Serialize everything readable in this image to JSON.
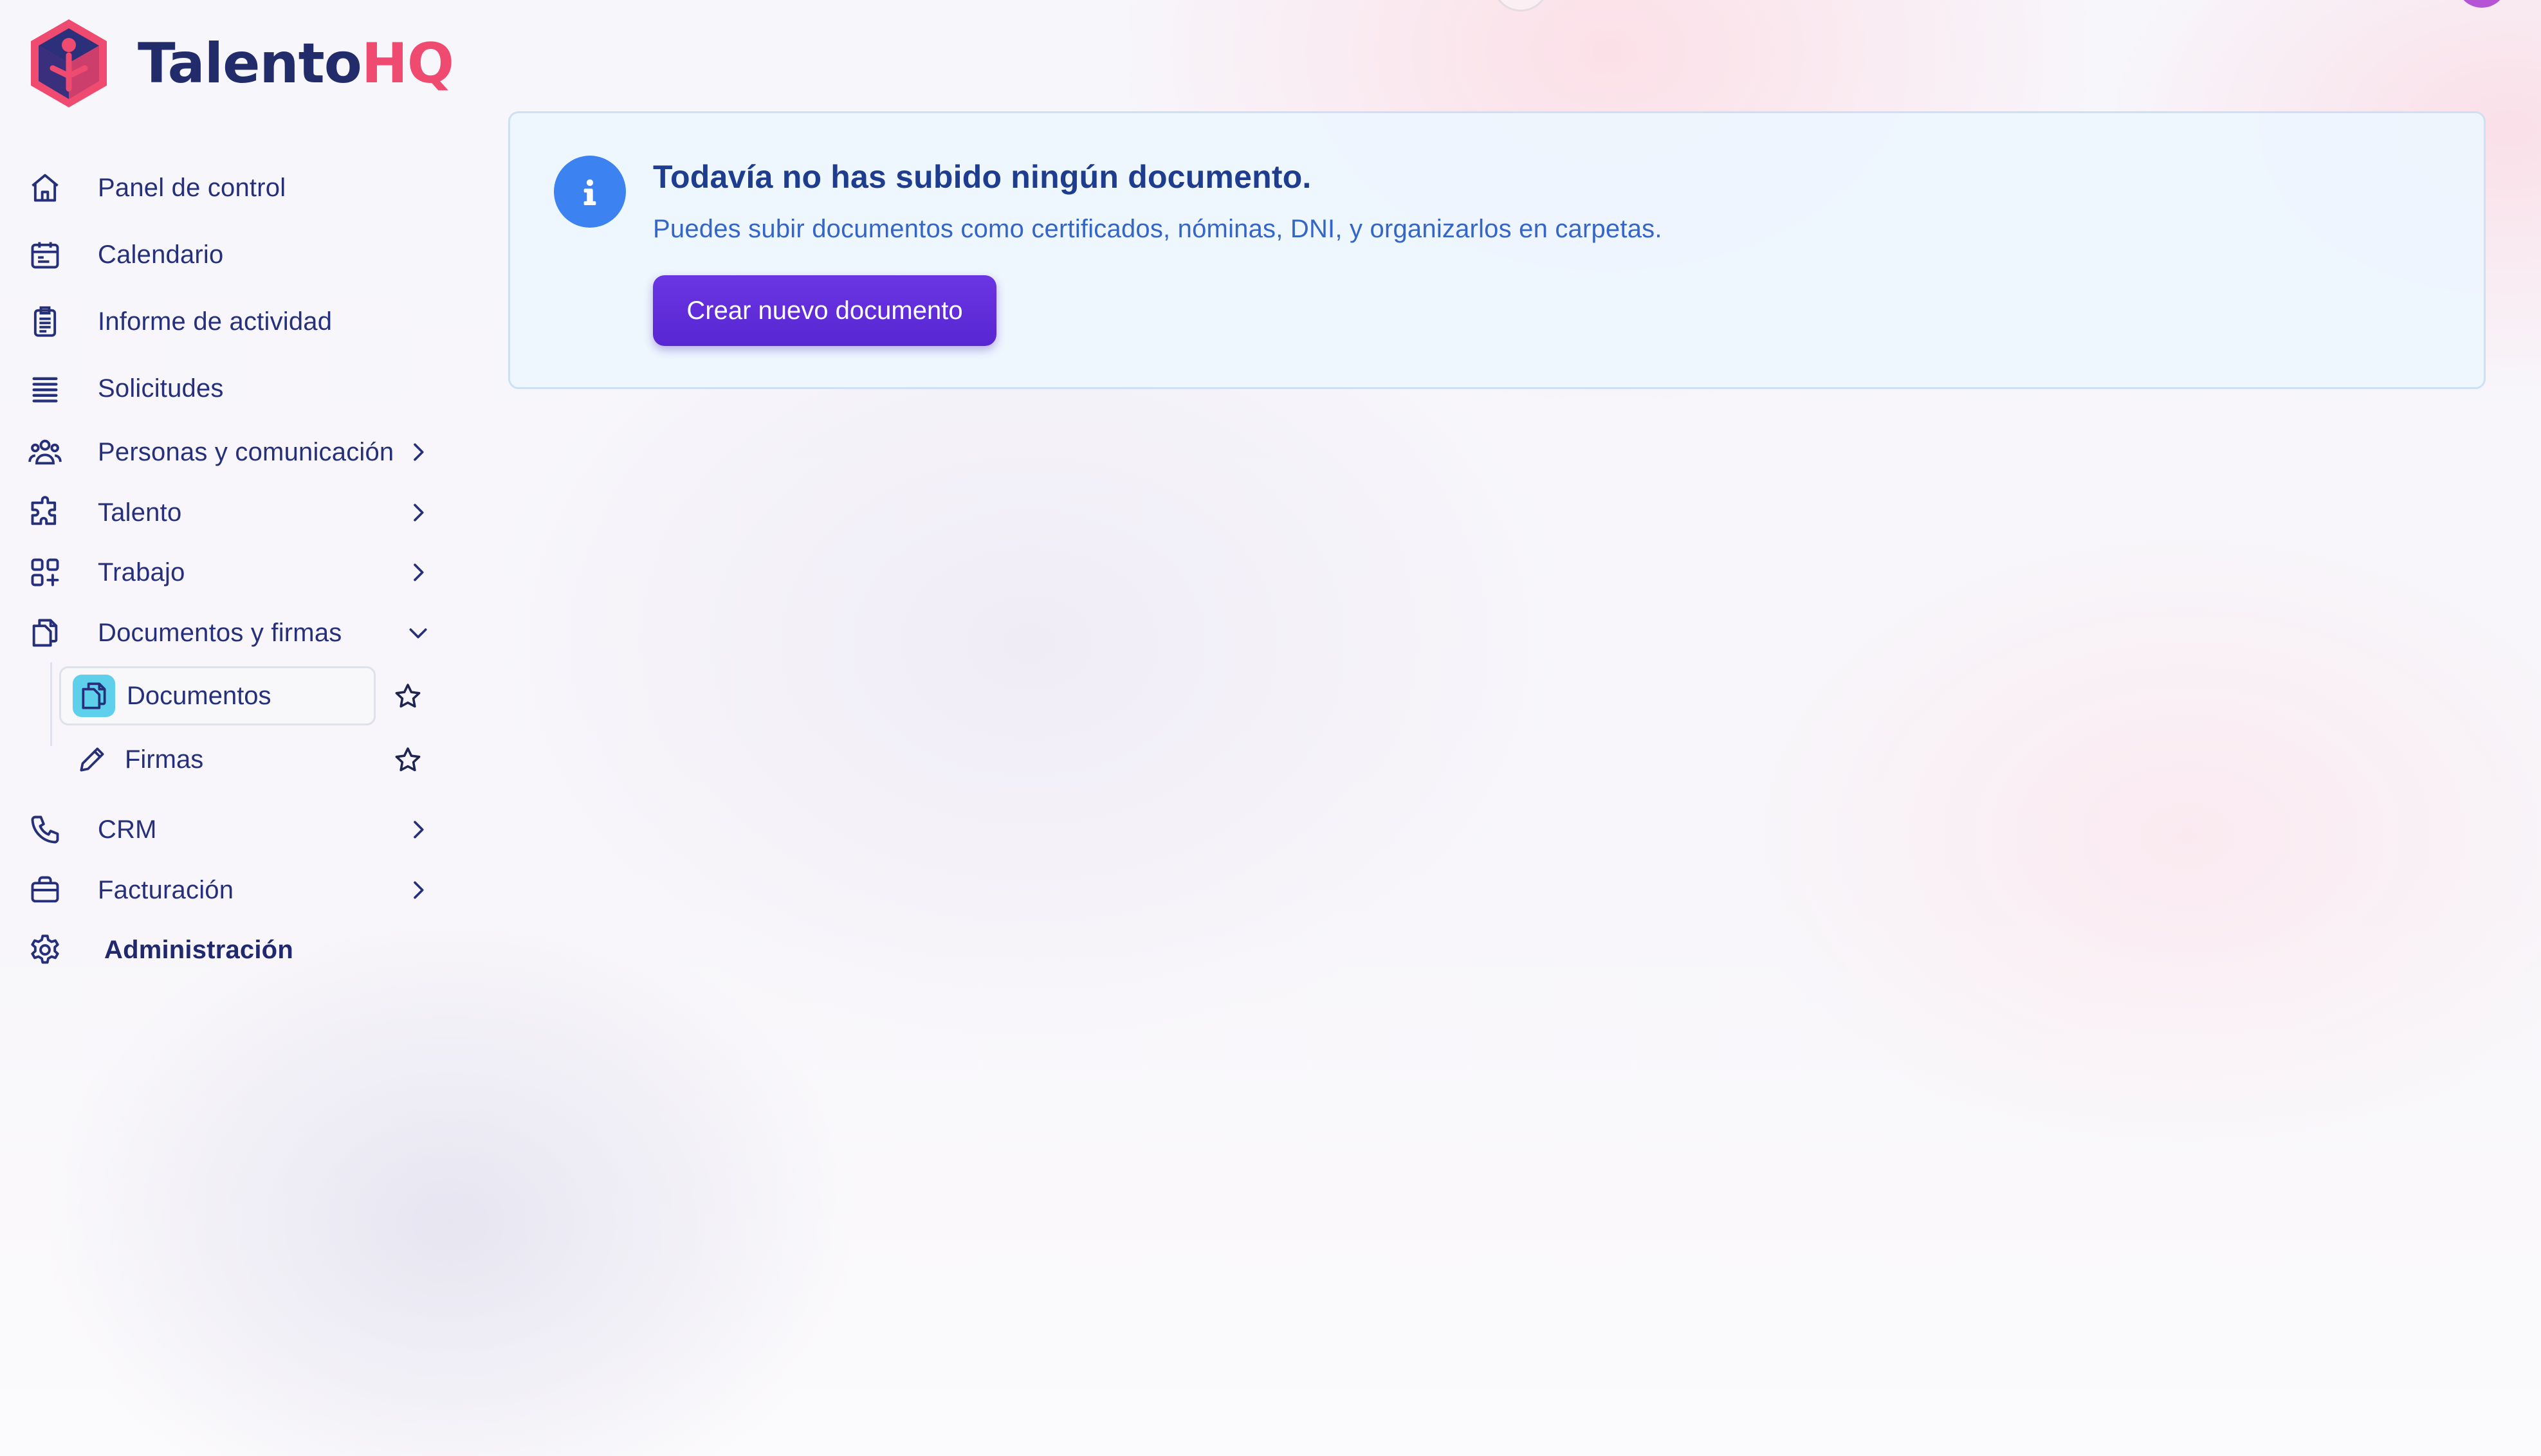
{
  "app": {
    "name_main": "Talento",
    "name_accent": "HQ"
  },
  "colors": {
    "brand_dark": "#232c6b",
    "brand_accent": "#ef4a70",
    "primary_button": "#5a28d4",
    "info": "#3c82f0",
    "nav_text": "#26307a"
  },
  "sidebar": {
    "items": [
      {
        "label": "Panel de control",
        "icon": "home-icon",
        "expandable": false
      },
      {
        "label": "Calendario",
        "icon": "calendar-icon",
        "expandable": false
      },
      {
        "label": "Informe de actividad",
        "icon": "clipboard-icon",
        "expandable": false
      },
      {
        "label": "Solicitudes",
        "icon": "list-icon",
        "expandable": false
      },
      {
        "label": "Personas y comunicación",
        "icon": "users-icon",
        "expandable": true,
        "expanded": false
      },
      {
        "label": "Talento",
        "icon": "puzzle-icon",
        "expandable": true,
        "expanded": false
      },
      {
        "label": "Trabajo",
        "icon": "apps-icon",
        "expandable": true,
        "expanded": false
      },
      {
        "label": "Documentos y firmas",
        "icon": "documents-icon",
        "expandable": true,
        "expanded": true
      },
      {
        "label": "CRM",
        "icon": "phone-icon",
        "expandable": true,
        "expanded": false
      },
      {
        "label": "Facturación",
        "icon": "briefcase-icon",
        "expandable": true,
        "expanded": false
      },
      {
        "label": "Administración",
        "icon": "gear-icon",
        "expandable": false
      }
    ],
    "subitems": [
      {
        "label": "Documentos",
        "icon": "documents-icon",
        "active": true,
        "favorite_icon": "star-icon"
      },
      {
        "label": "Firmas",
        "icon": "pencil-icon",
        "active": false,
        "favorite_icon": "star-icon"
      }
    ]
  },
  "main": {
    "alert": {
      "icon": "info-icon",
      "title": "Todavía no has subido ningún documento.",
      "description": "Puedes subir documentos como certificados, nóminas, DNI, y organizarlos en carpetas.",
      "button_label": "Crear nuevo documento"
    }
  }
}
